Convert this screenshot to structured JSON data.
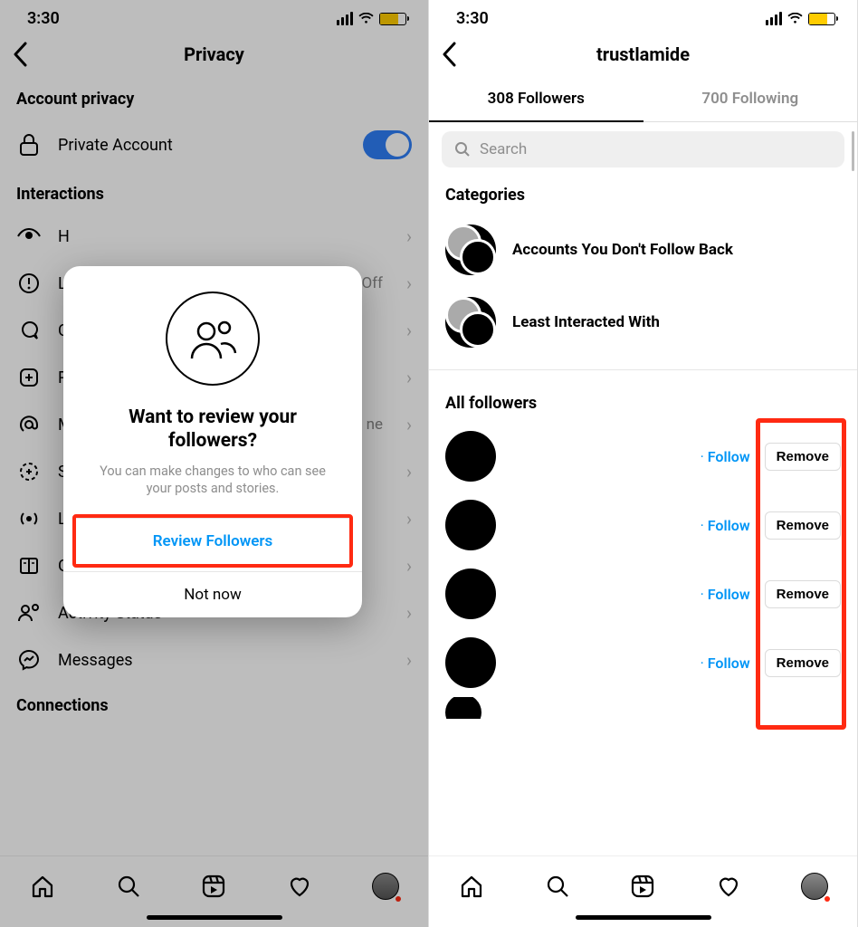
{
  "status": {
    "time": "3:30"
  },
  "left": {
    "title": "Privacy",
    "sec_account": "Account privacy",
    "private_account": "Private Account",
    "sec_interactions": "Interactions",
    "rows": {
      "hidden": "H",
      "limits": "L",
      "limits_trail": "Off",
      "comments": "C",
      "posts": "P",
      "mentions": "M",
      "mentions_trail": "ne",
      "story": "S",
      "live": "L",
      "guides": "G",
      "activity": "Activity Status",
      "messages": "Messages"
    },
    "sec_connections": "Connections",
    "modal": {
      "title": "Want to review your followers?",
      "body": "You can make changes to who can see your posts and stories.",
      "primary": "Review Followers",
      "secondary": "Not now"
    }
  },
  "right": {
    "username": "trustlamide",
    "followers_tab": "308 Followers",
    "following_tab": "700 Following",
    "search_placeholder": "Search",
    "sec_categories": "Categories",
    "cat1": "Accounts You Don't Follow Back",
    "cat2": "Least Interacted With",
    "sec_all": "All followers",
    "follow": "Follow",
    "remove": "Remove"
  }
}
